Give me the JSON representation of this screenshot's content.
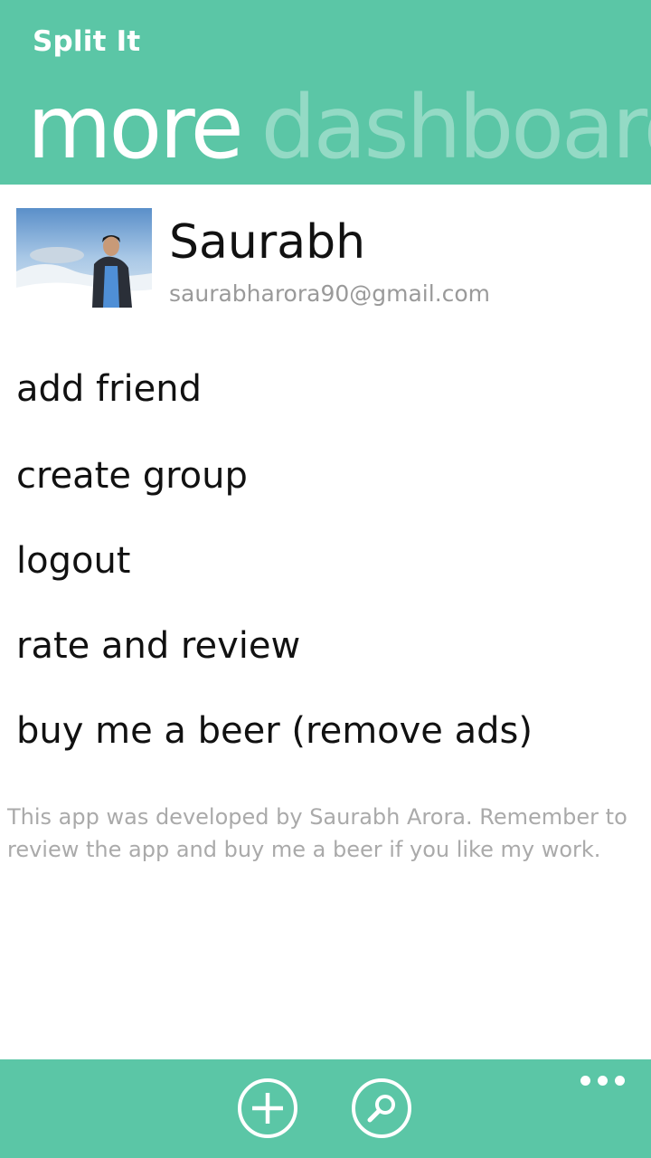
{
  "header": {
    "app_title": "Split It",
    "pivot_active": "more",
    "pivot_next": "dashboard",
    "accent_color": "#5bc6a6"
  },
  "profile": {
    "name": "Saurabh",
    "email": "saurabharora90@gmail.com"
  },
  "menu": {
    "items": [
      {
        "label": "add friend"
      },
      {
        "label": "create group"
      },
      {
        "label": "logout"
      },
      {
        "label": "rate and review"
      },
      {
        "label": "buy me a beer (remove ads)"
      }
    ]
  },
  "about": {
    "text": "This app was developed by Saurabh Arora. Remember to review the app and buy me a beer if you like my work."
  },
  "appbar": {
    "buttons": [
      {
        "icon": "add-icon"
      },
      {
        "icon": "search-icon"
      }
    ],
    "more_icon": "ellipsis-icon"
  }
}
